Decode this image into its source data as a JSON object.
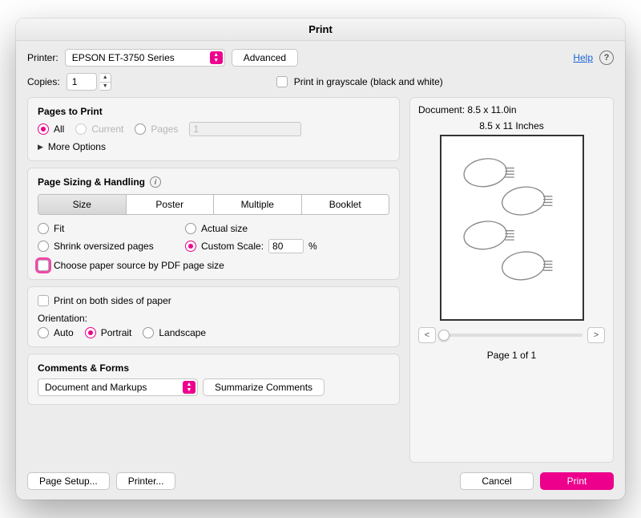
{
  "title": "Print",
  "help_label": "Help",
  "printer": {
    "label": "Printer:",
    "value": "EPSON ET-3750 Series",
    "advanced_label": "Advanced"
  },
  "copies": {
    "label": "Copies:",
    "value": "1",
    "grayscale_label": "Print in grayscale (black and white)"
  },
  "pages": {
    "title": "Pages to Print",
    "all": "All",
    "current": "Current",
    "pages": "Pages",
    "pages_value": "1",
    "more_options": "More Options"
  },
  "sizing": {
    "title": "Page Sizing & Handling",
    "tabs": {
      "size": "Size",
      "poster": "Poster",
      "multiple": "Multiple",
      "booklet": "Booklet"
    },
    "fit": "Fit",
    "actual": "Actual size",
    "shrink": "Shrink oversized pages",
    "custom_scale": "Custom Scale:",
    "scale_value": "80",
    "percent": "%",
    "choose_paper": "Choose paper source by PDF page size"
  },
  "duplex": {
    "both_sides": "Print on both sides of paper",
    "orientation_label": "Orientation:",
    "auto": "Auto",
    "portrait": "Portrait",
    "landscape": "Landscape"
  },
  "comments": {
    "title": "Comments & Forms",
    "value": "Document and Markups",
    "summarize": "Summarize Comments"
  },
  "preview": {
    "document_label": "Document: 8.5 x 11.0in",
    "size_label": "8.5 x 11 Inches",
    "page_label": "Page 1 of 1",
    "prev": "<",
    "next": ">"
  },
  "footer": {
    "page_setup": "Page Setup...",
    "printer": "Printer...",
    "cancel": "Cancel",
    "print": "Print"
  }
}
